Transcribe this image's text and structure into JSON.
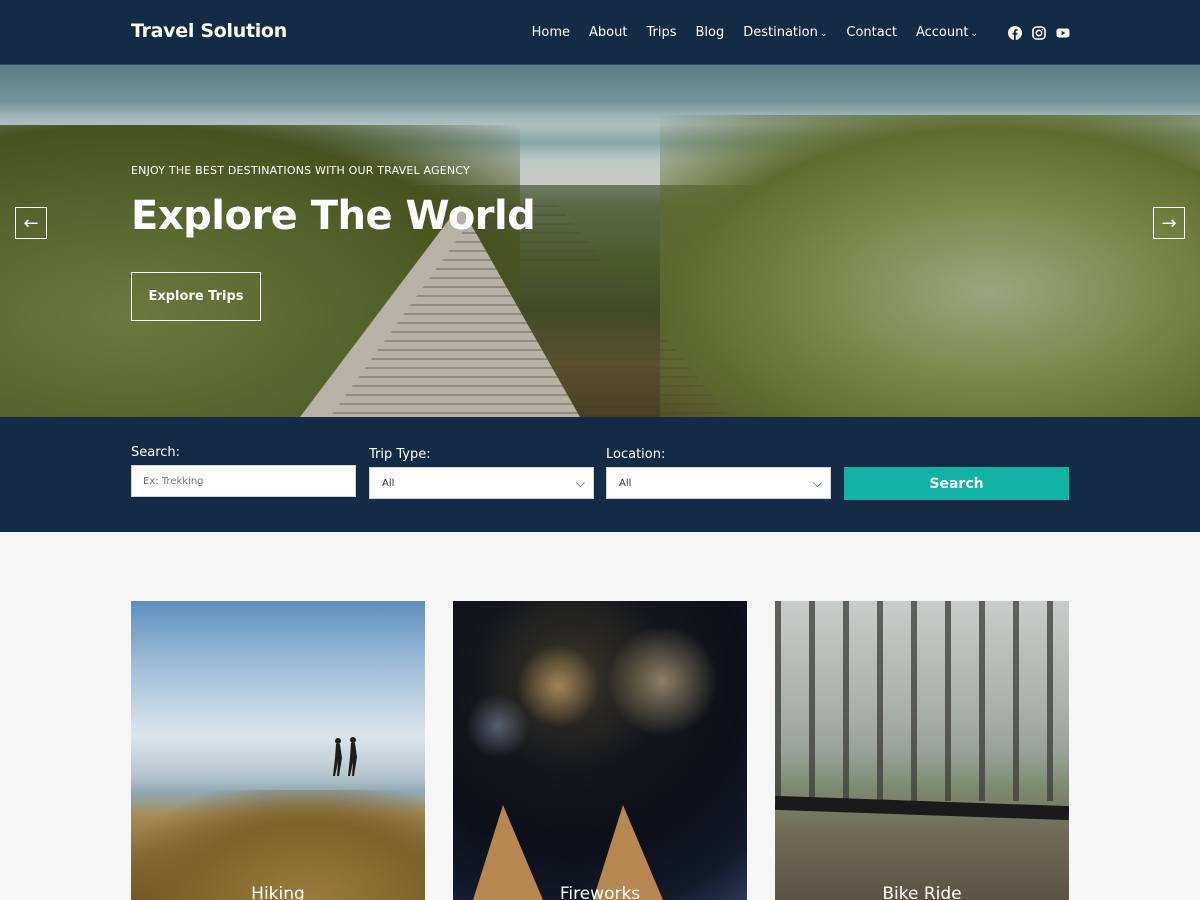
{
  "header": {
    "logo": "Travel Solution",
    "nav": [
      {
        "label": "Home"
      },
      {
        "label": "About"
      },
      {
        "label": "Trips"
      },
      {
        "label": "Blog"
      },
      {
        "label": "Destination",
        "dropdown": true
      },
      {
        "label": "Contact"
      },
      {
        "label": "Account",
        "dropdown": true
      }
    ],
    "social_icons": [
      "facebook-icon",
      "instagram-icon",
      "youtube-icon"
    ]
  },
  "hero": {
    "subtitle": "ENJOY THE BEST DESTINATIONS WITH OUR TRAVEL AGENCY",
    "title": "Explore The World",
    "button": "Explore Trips",
    "prev_icon": "arrow-left-icon",
    "next_icon": "arrow-right-icon",
    "prev_glyph": "←",
    "next_glyph": "→"
  },
  "search": {
    "search_label": "Search:",
    "search_placeholder": "Ex: Trekking",
    "trip_type_label": "Trip Type:",
    "trip_type_value": "All",
    "location_label": "Location:",
    "location_value": "All",
    "button": "Search",
    "chevron": "⌵"
  },
  "cards": [
    {
      "title": "Hiking"
    },
    {
      "title": "Fireworks"
    },
    {
      "title": "Bike Ride"
    }
  ],
  "colors": {
    "header_bg": "#142b45",
    "accent": "#12b3a5",
    "page_bg": "#f6f6f6"
  }
}
